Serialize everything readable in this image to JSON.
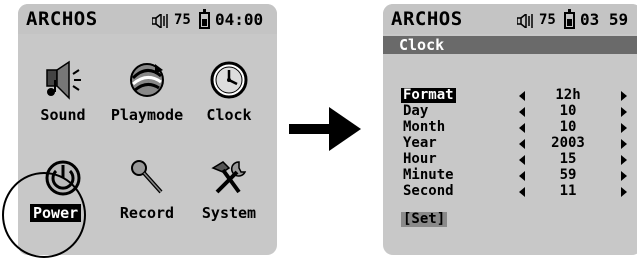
{
  "status": {
    "brand": "ARCHOS",
    "volume": "75",
    "time_left": "04:00",
    "time_right": "03 59"
  },
  "main_menu": {
    "items": [
      {
        "label": "Sound",
        "icon": "sound-icon"
      },
      {
        "label": "Playmode",
        "icon": "playmode-icon"
      },
      {
        "label": "Clock",
        "icon": "clock-icon"
      },
      {
        "label": "Power",
        "icon": "power-icon",
        "selected": true
      },
      {
        "label": "Record",
        "icon": "microphone-icon"
      },
      {
        "label": "System",
        "icon": "tools-icon"
      }
    ]
  },
  "clock_screen": {
    "title": "Clock",
    "rows": [
      {
        "label": "Format",
        "value": "12h",
        "selected": true
      },
      {
        "label": "Day",
        "value": "10"
      },
      {
        "label": "Month",
        "value": "10"
      },
      {
        "label": "Year",
        "value": "2003"
      },
      {
        "label": "Hour",
        "value": "15"
      },
      {
        "label": "Minute",
        "value": "59"
      },
      {
        "label": "Second",
        "value": "11"
      }
    ],
    "set_label": "[Set]"
  },
  "colors": {
    "screen_bg": "#c8c8c8",
    "titlebar_bg": "#6a6a6a",
    "selection_bg": "#000000",
    "set_button_bg": "#8a8a8a"
  }
}
